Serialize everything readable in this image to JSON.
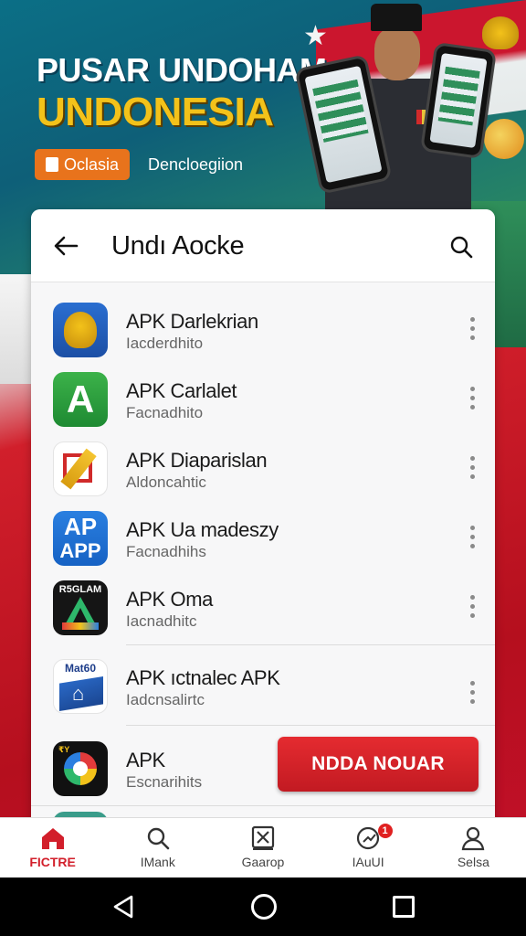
{
  "banner": {
    "title_line1": "PUSAR UNDOHAM",
    "title_line2": "UNDONESIA",
    "button_label": "Oclasia",
    "subtitle": "Dencloegiion"
  },
  "header": {
    "title": "Undı Aocke"
  },
  "apps": [
    {
      "name": "APK Darlekrian",
      "subtitle": "Iacderdhito",
      "icon": "garuda-emblem-icon"
    },
    {
      "name": "APK Carlalet",
      "subtitle": "Facnadhito",
      "icon": "green-a-icon"
    },
    {
      "name": "APK Diaparislan",
      "subtitle": "Aldoncahtic",
      "icon": "pencil-square-icon"
    },
    {
      "name": "APK Ua madeszy",
      "subtitle": "Facnadhihs",
      "icon": "ap-app-icon"
    },
    {
      "name": "APK Oma",
      "subtitle": "Iacnadhitc",
      "icon": "triangle-logo-icon"
    },
    {
      "name": "APK ıctnalec APK",
      "subtitle": "Iadcnsalirtc",
      "icon": "blue-building-icon"
    },
    {
      "name": "APK",
      "subtitle": "Escnarihits",
      "icon": "color-wheel-icon"
    }
  ],
  "icon_labels": {
    "app5": "R5GLAM",
    "app6": "Mat60",
    "app7": "₹Y",
    "app4_top": "AP",
    "app4_bottom": "APP",
    "app2": "A"
  },
  "cta": {
    "label": "NDDA NOUAR"
  },
  "bottom_nav": [
    {
      "label": "FICTRE",
      "icon": "home-icon",
      "active": true
    },
    {
      "label": "IMank",
      "icon": "search-icon"
    },
    {
      "label": "Gaarop",
      "icon": "box-x-icon"
    },
    {
      "label": "IAuUI",
      "icon": "notification-icon",
      "badge": "1"
    },
    {
      "label": "Selsa",
      "icon": "user-icon"
    }
  ],
  "colors": {
    "accent_red": "#d21f2b",
    "banner_orange": "#e8731c",
    "title_yellow": "#f3c21a"
  }
}
